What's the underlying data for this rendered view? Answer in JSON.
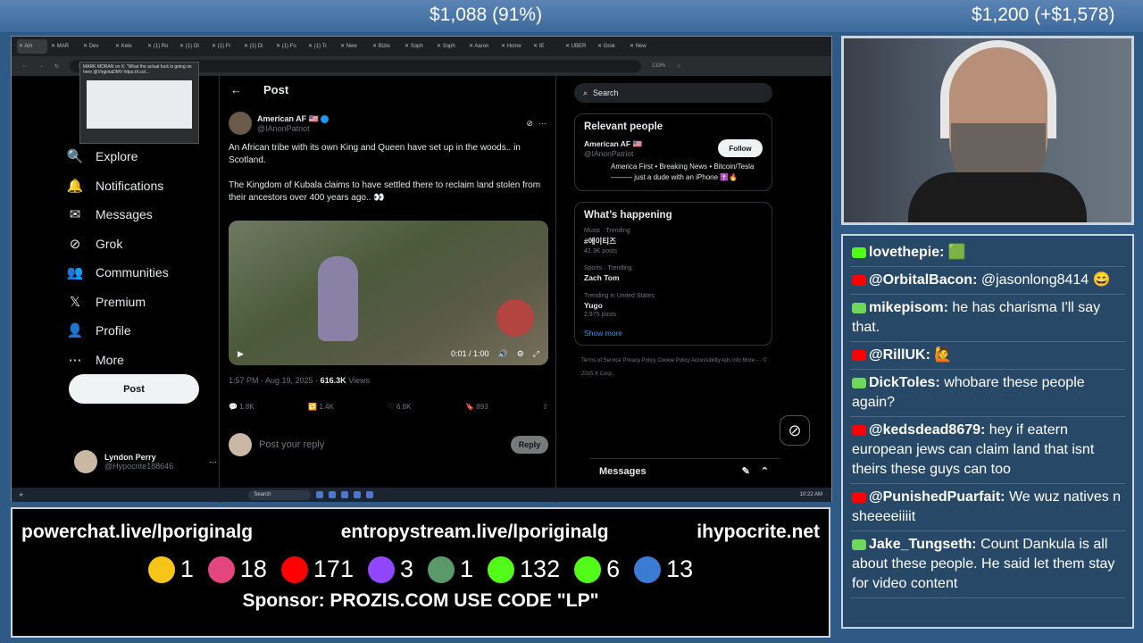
{
  "banner": {
    "left_amount": "$1,088 (91%)",
    "right_amount": "$1,200 (+$1,578)"
  },
  "browser": {
    "tabs": [
      "Am",
      "MAR",
      "Dev",
      "Kele",
      "(1) Ro",
      "(1) Ol",
      "(1) Fr",
      "(1) Di",
      "(1) Fo",
      "(1) Tr",
      "New",
      "Bizle",
      "Soph",
      "Soph",
      "Aaron",
      "Home",
      "IE",
      "UBER",
      "Grok",
      "New"
    ],
    "address": "x.com/IAnonPatriot/status/1957909809178767827",
    "zoom": "133%",
    "tooltip_title": "MARK MORAN on X: \"What the actual fuck is going on here @VirginiaDMV https://t.co/..."
  },
  "nav": {
    "items": [
      {
        "label": "Explore",
        "icon": "🔍"
      },
      {
        "label": "Notifications",
        "icon": "🔔"
      },
      {
        "label": "Messages",
        "icon": "✉"
      },
      {
        "label": "Grok",
        "icon": "⊘"
      },
      {
        "label": "Communities",
        "icon": "👥"
      },
      {
        "label": "Premium",
        "icon": "𝕏"
      },
      {
        "label": "Profile",
        "icon": "👤"
      },
      {
        "label": "More",
        "icon": "⋯"
      }
    ],
    "post_label": "Post"
  },
  "user": {
    "name": "Lyndon Perry",
    "handle": "@Hypocrite188646"
  },
  "post": {
    "header": "Post",
    "author_name": "American AF 🇺🇸",
    "author_handle": "@IAnonPatriot",
    "text1": "An African tribe with its own King and Queen have set up in the woods.. in Scotland.",
    "text2": "The Kingdom of Kubala claims to have settled there to reclaim land stolen from their ancestors over 400 years ago.. 👀",
    "video_time": "0:01 / 1:00",
    "timestamp": "1:57 PM · Aug 19, 2025 ·",
    "views": "616.3K",
    "views_label": "Views",
    "replies": "1.8K",
    "reposts": "1.4K",
    "likes": "6.8K",
    "bookmarks": "893",
    "reply_placeholder": "Post your reply",
    "reply_button": "Reply"
  },
  "sidebar": {
    "search_placeholder": "Search",
    "relevant_title": "Relevant people",
    "person_name": "American AF 🇺🇸",
    "person_handle": "@IAnonPatriot",
    "person_bio": "America First • Breaking News • Bitcoin/Tesla——— just a dude with an iPhone ✝️🔥",
    "follow_label": "Follow",
    "happening_title": "What’s happening",
    "trends": [
      {
        "context": "Music · Trending",
        "name": "#에이티즈",
        "count": "42.3K posts"
      },
      {
        "context": "Sports · Trending",
        "name": "Zach Tom",
        "count": ""
      },
      {
        "context": "Trending in United States",
        "name": "Yugo",
        "count": "2,975 posts"
      }
    ],
    "show_more": "Show more",
    "footer": "Terms of Service   Privacy Policy   Cookie Policy   Accessibility   Ads info   More ···   © 2025 X Corp.",
    "messages_label": "Messages"
  },
  "taskbar": {
    "search": "Search",
    "time": "10:22 AM"
  },
  "chat": [
    {
      "name": "lovethepie:",
      "text": "🟩",
      "platform_color": "#53fc18"
    },
    {
      "name": "@OrbitalBacon:",
      "text": "@jasonlong8414 😄",
      "platform_color": "#ff0000"
    },
    {
      "name": "mikepisom:",
      "text": "he has charisma I'll say that.",
      "platform_color": "#6fd85a"
    },
    {
      "name": "@RillUK:",
      "text": "🙋",
      "platform_color": "#ff0000"
    },
    {
      "name": "DickToles:",
      "text": "whobare these people again?",
      "platform_color": "#6fd85a"
    },
    {
      "name": "@kedsdead8679:",
      "text": "hey if eatern european jews can claim land that isnt theirs these guys can too",
      "platform_color": "#ff0000"
    },
    {
      "name": "@PunishedPuarfait:",
      "text": "We wuz natives n sheeeeiiiit",
      "platform_color": "#ff0000"
    },
    {
      "name": "Jake_Tungseth:",
      "text": "Count Dankula is all about these people. He said let them stay for video content",
      "platform_color": "#6fd85a"
    }
  ],
  "overlay": {
    "links": [
      "powerchat.live/lporiginalg",
      "entropystream.live/lporiginalg",
      "ihypocrite.net"
    ],
    "counts": [
      {
        "value": "1",
        "color": "#f5c518"
      },
      {
        "value": "18",
        "color": "#e3457e"
      },
      {
        "value": "171",
        "color": "#ff0000"
      },
      {
        "value": "3",
        "color": "#9146ff"
      },
      {
        "value": "1",
        "color": "#5a9a6a"
      },
      {
        "value": "132",
        "color": "#53fc18"
      },
      {
        "value": "6",
        "color": "#53fc18"
      },
      {
        "value": "13",
        "color": "#3b7bd4"
      }
    ],
    "sponsor": "Sponsor: PROZIS.COM USE CODE \"LP\""
  }
}
